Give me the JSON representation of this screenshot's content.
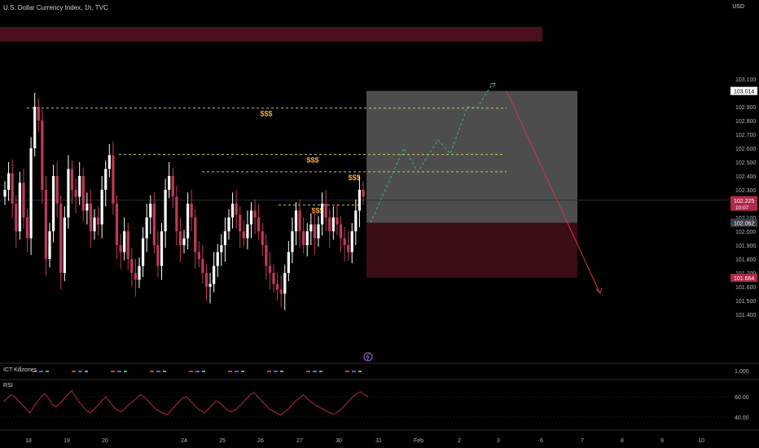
{
  "header": {
    "title": "U.S. Dollar Currency Index, 1h, TVC",
    "currency": "USD"
  },
  "chart_data": {
    "type": "candlestick",
    "y_ticks": [
      "103.100",
      "102.900",
      "102.800",
      "102.700",
      "102.600",
      "102.500",
      "102.400",
      "102.300",
      "102.100",
      "102.000",
      "101.900",
      "101.800",
      "101.700",
      "101.600",
      "101.500",
      "101.400"
    ],
    "ylim": [
      101.35,
      103.18
    ],
    "x_ticks": [
      {
        "label": "18",
        "slot": 0
      },
      {
        "label": "19",
        "slot": 1
      },
      {
        "label": "20",
        "slot": 2
      },
      {
        "label": "24",
        "slot": 3
      },
      {
        "label": "25",
        "slot": 4
      },
      {
        "label": "26",
        "slot": 5
      },
      {
        "label": "27",
        "slot": 6
      },
      {
        "label": "30",
        "slot": 7
      },
      {
        "label": "31",
        "slot": 8
      },
      {
        "label": "Feb",
        "slot": 9
      },
      {
        "label": "2",
        "slot": 10
      },
      {
        "label": "3",
        "slot": 11
      },
      {
        "label": "6",
        "slot": 12
      },
      {
        "label": "7",
        "slot": 13
      },
      {
        "label": "8",
        "slot": 14
      },
      {
        "label": "9",
        "slot": 15
      },
      {
        "label": "10",
        "slot": 16
      }
    ],
    "price_labels": {
      "target": {
        "text": "103.014",
        "value": 103.014
      },
      "last": {
        "text": "102.225",
        "value": 102.225,
        "countdown": "10:07"
      },
      "entry": {
        "text": "102.062",
        "value": 102.062
      },
      "stop": {
        "text": "101.664",
        "value": 101.664
      }
    },
    "close_series": [
      102.3,
      102.42,
      102.2,
      102.0,
      102.35,
      102.1,
      101.95,
      102.6,
      102.9,
      102.8,
      102.3,
      101.8,
      102.0,
      102.4,
      102.2,
      101.7,
      102.1,
      102.45,
      102.3,
      102.25,
      102.4,
      102.15,
      102.2,
      102.0,
      102.1,
      102.05,
      102.3,
      102.45,
      102.55,
      102.2,
      101.9,
      101.85,
      102.0,
      101.8,
      101.7,
      101.65,
      101.75,
      101.95,
      102.1,
      102.2,
      101.9,
      101.75,
      102.0,
      102.3,
      102.4,
      102.25,
      102.0,
      101.9,
      101.95,
      102.2,
      102.1,
      101.85,
      101.8,
      101.7,
      101.6,
      101.62,
      101.75,
      101.85,
      101.9,
      102.0,
      102.1,
      102.2,
      102.12,
      102.0,
      101.95,
      102.05,
      102.15,
      102.1,
      102.0,
      101.9,
      101.75,
      101.7,
      101.62,
      101.58,
      101.55,
      101.7,
      101.85,
      102.0,
      102.15,
      102.0,
      101.9,
      102.0,
      102.05,
      101.95,
      102.05,
      102.2,
      102.1,
      102.0,
      102.1,
      102.05,
      101.95,
      101.9,
      101.85,
      102.0,
      102.15,
      102.3,
      102.25
    ],
    "liquidity_levels": [
      {
        "label": "$$$",
        "value": 102.89
      },
      {
        "label": "$$$",
        "value": 102.555
      },
      {
        "label": "$$$",
        "value": 102.43
      },
      {
        "label": "$$$",
        "value": 102.19
      }
    ],
    "projection_up": [
      102.062,
      102.6,
      102.43,
      102.66,
      102.56,
      102.9,
      102.89,
      103.07
    ],
    "projection_down": [
      103.014,
      101.55
    ],
    "zones": {
      "resistance": [
        103.02,
        103.1
      ],
      "target_box": [
        102.062,
        103.014
      ],
      "stop_box": [
        101.664,
        102.062
      ]
    },
    "indicators": {
      "killzones": {
        "label": "ICT Killzones",
        "value_label": "1.000"
      },
      "rsi": {
        "label": "RSI",
        "ticks": [
          "60.00",
          "40.00"
        ],
        "values": [
          55,
          58,
          62,
          60,
          56,
          52,
          48,
          44,
          50,
          55,
          60,
          63,
          58,
          52,
          50,
          54,
          58,
          62,
          66,
          60,
          55,
          50,
          46,
          44,
          48,
          52,
          56,
          60,
          55,
          50,
          47,
          45,
          48,
          52,
          55,
          58,
          62,
          60,
          56,
          52,
          48,
          46,
          44,
          42,
          46,
          50,
          54,
          58,
          60,
          57,
          53,
          49,
          46,
          44,
          48,
          52,
          56,
          54,
          50,
          47,
          45,
          47,
          50,
          54,
          58,
          62,
          64,
          60,
          56,
          52,
          48,
          46,
          44,
          42,
          45,
          48,
          52,
          56,
          59,
          62,
          58,
          55,
          52,
          50,
          48,
          46,
          44,
          43,
          45,
          48,
          52,
          56,
          60,
          63,
          65,
          62,
          60
        ]
      }
    },
    "colors": {
      "up": "#ffffff",
      "down": "#c0395a",
      "level_line": "#c8c85a",
      "dollar_label": "#f0a640",
      "target_zone": "#5a5a5a",
      "stop_zone": "#3a0c14",
      "resistance_zone": "#4a0f1c",
      "projection_up": "#4caf72",
      "projection_down": "#d0354d",
      "last_price": "#b0274a",
      "rsi_line": "#b0274a"
    }
  }
}
